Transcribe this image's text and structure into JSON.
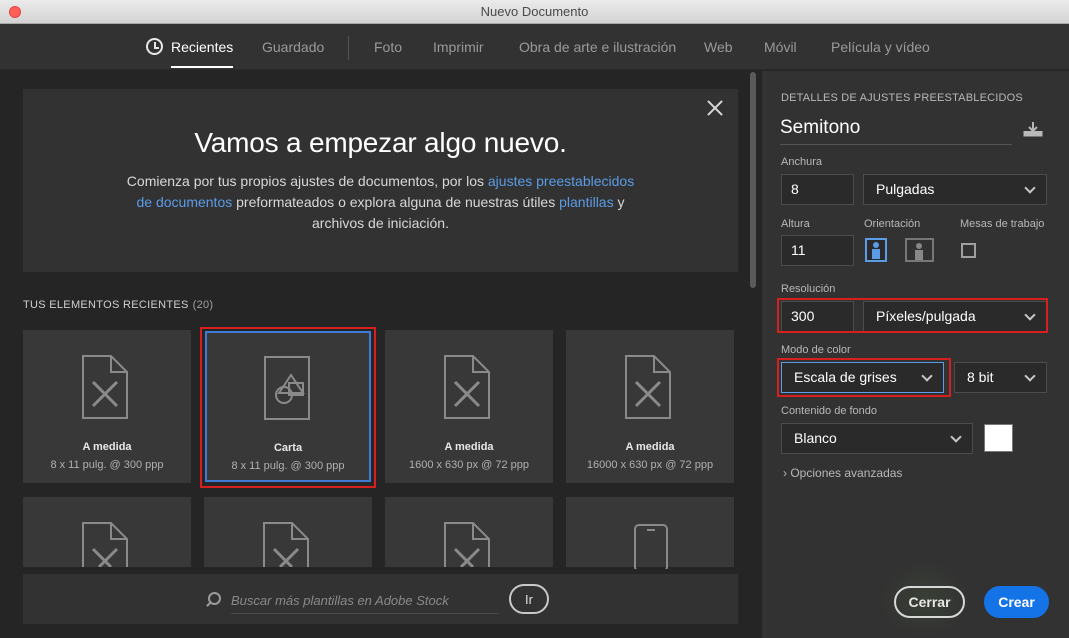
{
  "window": {
    "title": "Nuevo Documento"
  },
  "nav": {
    "tabs": [
      {
        "label": "Recientes",
        "active": true
      },
      {
        "label": "Guardado"
      },
      {
        "label": "Foto"
      },
      {
        "label": "Imprimir"
      },
      {
        "label": "Obra de arte e ilustración"
      },
      {
        "label": "Web"
      },
      {
        "label": "Móvil"
      },
      {
        "label": "Película y vídeo"
      }
    ]
  },
  "hero": {
    "heading": "Vamos a empezar algo nuevo.",
    "text_1": "Comienza por tus propios ajustes de documentos, por los ",
    "link_1": "ajustes preestablecidos de documentos",
    "text_2": " preformateados o explora alguna de nuestras útiles ",
    "link_2": "plantillas",
    "text_3": " y archivos de iniciación."
  },
  "recent": {
    "heading": "TUS ELEMENTOS RECIENTES",
    "count": "(20)",
    "items": [
      {
        "name": "A medida",
        "meta": "8 x 11 pulg. @ 300 ppp",
        "icon": "custom-document-icon"
      },
      {
        "name": "Carta",
        "meta": "8 x 11 pulg. @ 300 ppp",
        "icon": "shapes-document-icon",
        "selected": true
      },
      {
        "name": "A medida",
        "meta": "1600 x 630 px @ 72 ppp",
        "icon": "custom-document-icon"
      },
      {
        "name": "A medida",
        "meta": "16000 x 630 px @ 72 ppp",
        "icon": "custom-document-icon"
      },
      {
        "name": "",
        "meta": "",
        "icon": "custom-document-icon"
      },
      {
        "name": "",
        "meta": "",
        "icon": "custom-document-icon"
      },
      {
        "name": "",
        "meta": "",
        "icon": "custom-document-icon"
      },
      {
        "name": "",
        "meta": "",
        "icon": "mobile-device-icon"
      }
    ]
  },
  "search": {
    "placeholder": "Buscar más plantillas en Adobe Stock",
    "go_label": "Ir"
  },
  "details": {
    "title": "DETALLES DE AJUSTES PREESTABLECIDOS",
    "preset_name": "Semitono",
    "width_label": "Anchura",
    "width_value": "8",
    "width_unit": "Pulgadas",
    "height_label": "Altura",
    "height_value": "11",
    "orientation_label": "Orientación",
    "artboards_label": "Mesas de trabajo",
    "resolution_label": "Resolución",
    "resolution_value": "300",
    "resolution_unit": "Píxeles/pulgada",
    "color_mode_label": "Modo de color",
    "color_mode": "Escala de grises",
    "bit_depth": "8 bit",
    "background_label": "Contenido de fondo",
    "background": "Blanco",
    "background_color": "#ffffff",
    "advanced": "Opciones avanzadas"
  },
  "buttons": {
    "cancel": "Cerrar",
    "create": "Crear"
  },
  "colors": {
    "accent": "#1473e6",
    "link": "#5b9ce8",
    "highlight": "#d61f1f",
    "selection": "#3f7ad6"
  }
}
